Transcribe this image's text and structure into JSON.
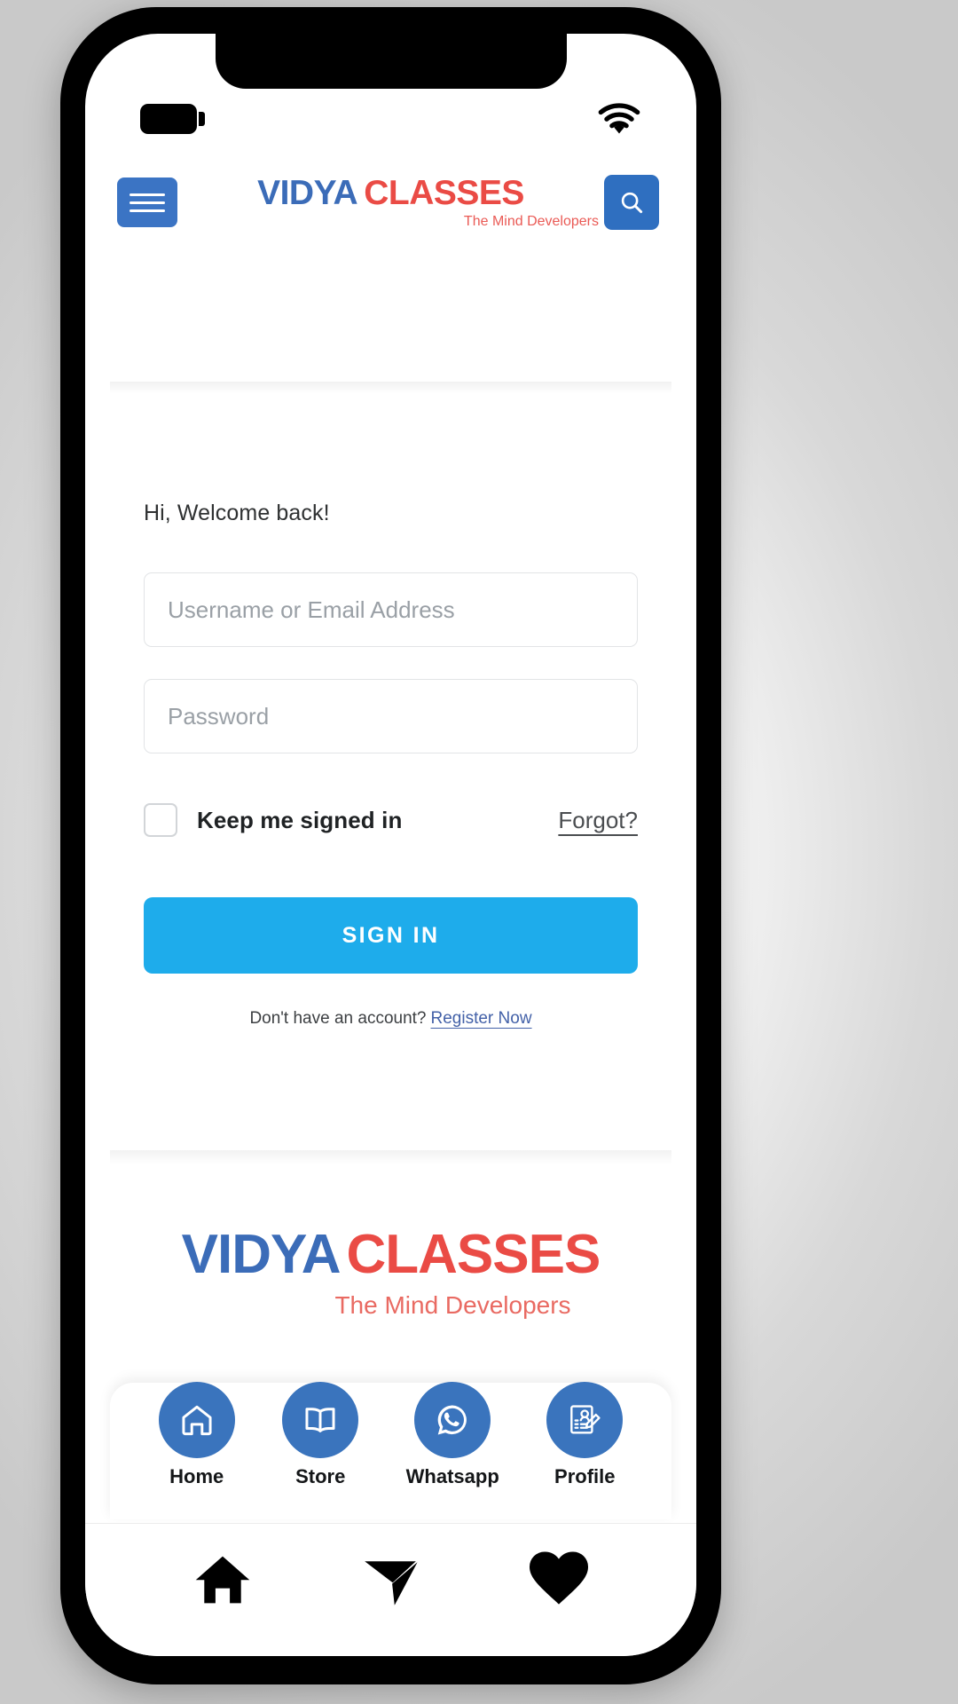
{
  "status_bar": {
    "battery_icon": "battery-icon",
    "wifi_icon": "wifi-icon"
  },
  "header": {
    "menu_icon": "hamburger-menu-icon",
    "search_icon": "search-icon",
    "logo": {
      "primary": "VIDYA",
      "secondary": "CLASSES",
      "tagline": "The Mind Developers",
      "primary_color": "#3b6cb8",
      "secondary_color": "#ea4b45"
    }
  },
  "login": {
    "welcome": "Hi, Welcome back!",
    "username_placeholder": "Username or Email Address",
    "username_value": "",
    "password_placeholder": "Password",
    "password_value": "",
    "keep_signed_label": "Keep me signed in",
    "keep_signed_checked": false,
    "forgot_label": "Forgot?",
    "signin_label": "SIGN IN",
    "signin_color": "#1eaceb",
    "register_prompt": "Don't have an account?",
    "register_link": "Register Now"
  },
  "footer_logo": {
    "primary": "VIDYA",
    "secondary": "CLASSES",
    "tagline": "The Mind Developers"
  },
  "bottom_nav": {
    "items": [
      {
        "label": "Home",
        "icon": "home-outline-icon"
      },
      {
        "label": "Store",
        "icon": "open-book-icon"
      },
      {
        "label": "Whatsapp",
        "icon": "whatsapp-icon"
      },
      {
        "label": "Profile",
        "icon": "profile-document-pencil-icon"
      }
    ],
    "circle_color": "#3a74bd"
  },
  "system_nav": {
    "items": [
      {
        "icon": "home-filled-icon"
      },
      {
        "icon": "send-paper-plane-icon"
      },
      {
        "icon": "heart-filled-icon"
      }
    ]
  }
}
